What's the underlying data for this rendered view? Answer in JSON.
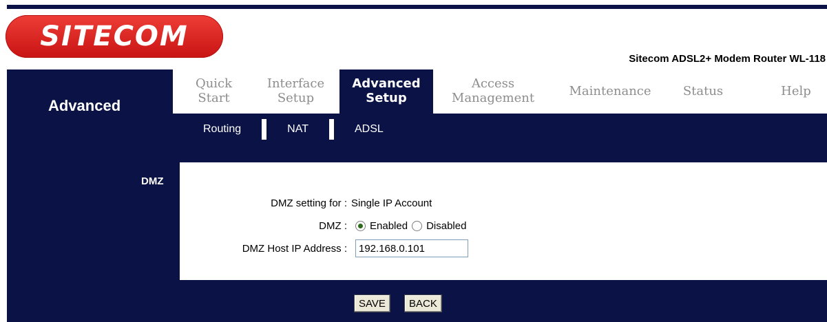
{
  "logo": {
    "text": "SITECOM"
  },
  "header": {
    "model_name": "Sitecom ADSL2+ Modem Router WL-118"
  },
  "section_title": "Advanced",
  "main_nav": [
    {
      "label": "Quick\nStart",
      "active": false
    },
    {
      "label": "Interface\nSetup",
      "active": false
    },
    {
      "label": "Advanced\nSetup",
      "active": true
    },
    {
      "label": "Access\nManagement",
      "active": false
    },
    {
      "label": "Maintenance",
      "active": false
    },
    {
      "label": "Status",
      "active": false
    },
    {
      "label": "Help",
      "active": false
    }
  ],
  "sub_nav": [
    "Routing",
    "NAT",
    "ADSL"
  ],
  "sidebar": {
    "label": "DMZ"
  },
  "form": {
    "setting_for_label": "DMZ setting for :",
    "setting_for_value": "Single IP Account",
    "dmz_label": "DMZ :",
    "enabled_label": "Enabled",
    "disabled_label": "Disabled",
    "dmz_selected": "Enabled",
    "host_ip_label": "DMZ Host IP Address :",
    "host_ip_value": "192.168.0.101"
  },
  "buttons": {
    "save": "SAVE",
    "back": "BACK"
  },
  "colors": {
    "navy": "#0b1245",
    "logo_red": "#e02a25",
    "inactive_tab": "#8d8d8d"
  }
}
